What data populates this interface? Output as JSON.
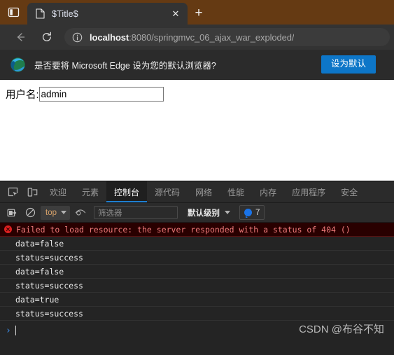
{
  "browser": {
    "tab_overview_icon": "tab-overview-icon",
    "tab": {
      "favicon": "page-favicon-icon",
      "title": "$Title$",
      "close_label": "✕"
    },
    "new_tab_label": "+",
    "nav": {
      "back_icon": "back-arrow-icon",
      "reload_icon": "reload-icon",
      "info_icon": "info-circle-icon",
      "url_host": "localhost",
      "url_rest": ":8080/springmvc_06_ajax_war_exploded/"
    },
    "prompt": {
      "logo": "edge-logo-icon",
      "text": "是否要将 Microsoft Edge 设为您的默认浏览器?",
      "button_label": "设为默认",
      "button_color": "#0d76c8"
    }
  },
  "page": {
    "form": {
      "label": "用户名:",
      "input_value": "admin",
      "input_placeholder": ""
    }
  },
  "devtools": {
    "left_icons": [
      {
        "name": "inspect-element-icon"
      },
      {
        "name": "device-toolbar-icon"
      }
    ],
    "tabs": [
      {
        "label": "欢迎",
        "active": false
      },
      {
        "label": "元素",
        "active": false
      },
      {
        "label": "控制台",
        "active": true
      },
      {
        "label": "源代码",
        "active": false
      },
      {
        "label": "网络",
        "active": false
      },
      {
        "label": "性能",
        "active": false
      },
      {
        "label": "内存",
        "active": false
      },
      {
        "label": "应用程序",
        "active": false
      },
      {
        "label": "安全",
        "active": false
      }
    ],
    "toolbar": {
      "clear_console_icon": "clear-console-icon",
      "no_entry_icon": "no-entry-icon",
      "context_value": "top",
      "eye_icon": "live-expression-eye-icon",
      "filter_placeholder": "筛选器",
      "level_label": "默认级别",
      "message_count": "7",
      "badge_color": "#1a73e8"
    },
    "console_logs": [
      {
        "type": "error",
        "text": "Failed to load resource: the server responded with a status of 404 ()"
      },
      {
        "type": "log",
        "text": "data=false"
      },
      {
        "type": "log",
        "text": "status=success"
      },
      {
        "type": "log",
        "text": "data=false"
      },
      {
        "type": "log",
        "text": "status=success"
      },
      {
        "type": "log",
        "text": "data=true"
      },
      {
        "type": "log",
        "text": "status=success"
      }
    ],
    "prompt_symbol": "›",
    "watermark": "CSDN @布谷不知"
  }
}
